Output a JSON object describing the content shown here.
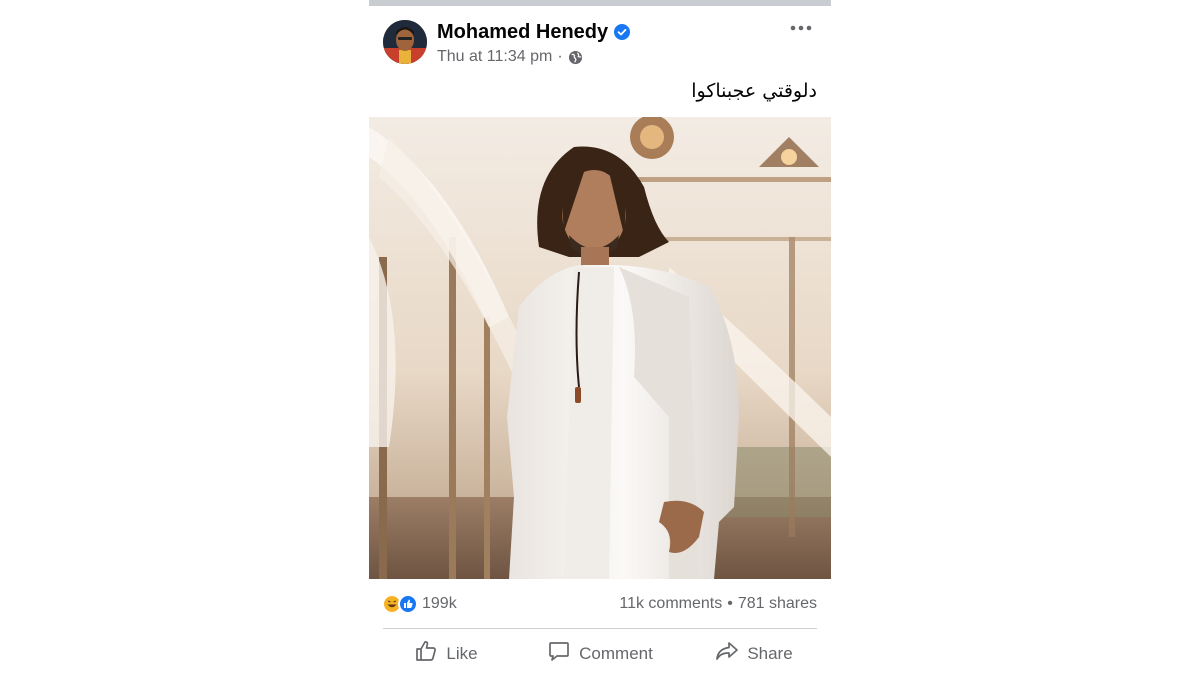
{
  "post": {
    "author": "Mohamed Henedy",
    "timestamp": "Thu at 11:34 pm",
    "separator": "·",
    "caption": "دلوقتي عجبناكوا",
    "reaction_count": "199k",
    "comments": "11k comments",
    "bullet": "•",
    "shares": "781 shares"
  },
  "actions": {
    "like": "Like",
    "comment": "Comment",
    "share": "Share"
  },
  "icons": {
    "verified": "verified-badge-icon",
    "visibility": "globe-icon",
    "menu": "more-options-icon",
    "reactions": [
      "haha-reaction-icon",
      "like-reaction-icon"
    ],
    "like": "thumbs-up-icon",
    "comment": "speech-bubble-icon",
    "share": "share-arrow-icon"
  },
  "colors": {
    "verified": "#1877f2",
    "secondary_text": "#65676b",
    "like_reaction": "#1877f2",
    "haha_reaction": "#f7b125"
  }
}
